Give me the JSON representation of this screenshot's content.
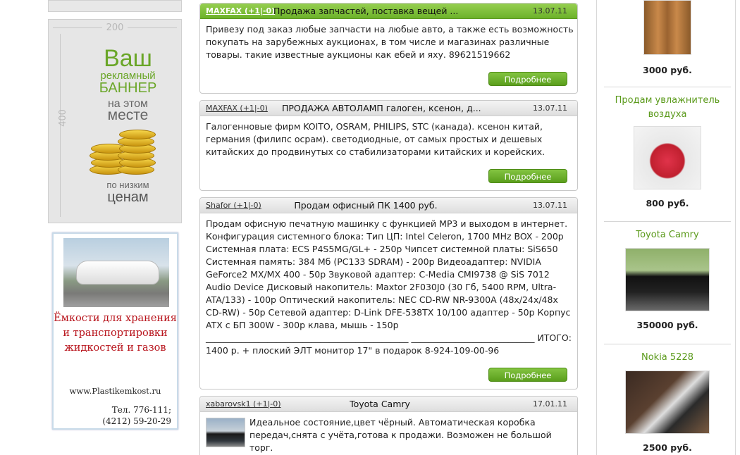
{
  "left": {
    "banner": {
      "width_label": "200",
      "height_label": "400",
      "line1": "Ваш",
      "line2": "рекламный",
      "line3": "БАННЕР",
      "line4": "на этом",
      "line5": "месте",
      "line6": "по низким",
      "line7": "ценам"
    },
    "ad": {
      "title": "Ёмкости для хранения и транспортировки жидкостей и газов",
      "url": "www.Plastikemkost.ru",
      "phone1": "Тел. 776-111;",
      "phone2": "(4212) 59-20-29"
    }
  },
  "listings": [
    {
      "author": "MAXFAX (+1|-0)",
      "title": "Продажа запчастей, поставка вещей ...",
      "date": "13.07.11",
      "body": "Привезу под заказ любые запчасти на любые авто, а также есть возможность покупать на зарубежных аукционах, в том числе и магазинах различные товары. такие известные аукционы как ебей и яху. 89621519662",
      "more": "Подробнее"
    },
    {
      "author": "MAXFAX (+1|-0)",
      "title": "ПРОДАЖА АВТОЛАМП галоген, ксенон, д...",
      "date": "13.07.11",
      "body": "Галогенновые фирм KOITO, OSRAM, PHILIPS, STC (канада). ксенон китай, германия (филипс осрам). светодиодные, от самых простых и дешевых китайских до продвинутых со стабилизаторами китайских и корейских.",
      "more": "Подробнее"
    },
    {
      "author": "Shafor (+1|-0)",
      "title": "Продам офисный ПК 1400 руб.",
      "date": "13.07.11",
      "body": "Продам офисную печатную машинку с функцией MP3 и выходом в интернет. Конфигурация системного блока: Тип ЦП: Intel Celeron, 1700 MHz BOX - 200р Системная плата: ECS P4S5MG/GL+ - 250р Чипсет системной платы: SiS650 Системная память: 384 Мб (PC133 SDRAM) - 200р Видеоадаптер: NVIDIA GeForce2 MX/MX 400 - 50р Звуковой адаптер: C-Media CMI9738 @ SiS 7012 Audio Device Дисковый накопитель: Maxtor 2F030J0 (30 Гб, 5400 RPM, Ultra-ATA/133) - 100р Оптический накопитель: NEC CD-RW NR-9300A (48x/24x/48x CD-RW) - 50р Сетевой адаптер: D-Link DFE-538TX 10/100 адаптер - 50р Корпус ATX с БП 300W - 300р клава, мышь - 150р ______________________________________________ ____________________________ ИТОГО: 1400 р. + плоский ЭЛТ монитор 17\" в подарок 8-924-109-00-96",
      "more": "Подробнее"
    },
    {
      "author": "xabarovsk1 (+1|-0)",
      "title": "Toyota Camry",
      "date": "17.01.11",
      "body": "Идеальное состояние,цвет чёрный. Автоматическая коробка передач,снята с учёта,готова к продажи. Возможен не большой торг."
    }
  ],
  "right": [
    {
      "title": "",
      "price": "3000 руб."
    },
    {
      "title": "Продам увлажнитель воздуха",
      "price": "800 руб."
    },
    {
      "title": "Toyota Camry",
      "price": "350000 руб."
    },
    {
      "title": "Nokia 5228",
      "price": "2500 руб."
    }
  ]
}
